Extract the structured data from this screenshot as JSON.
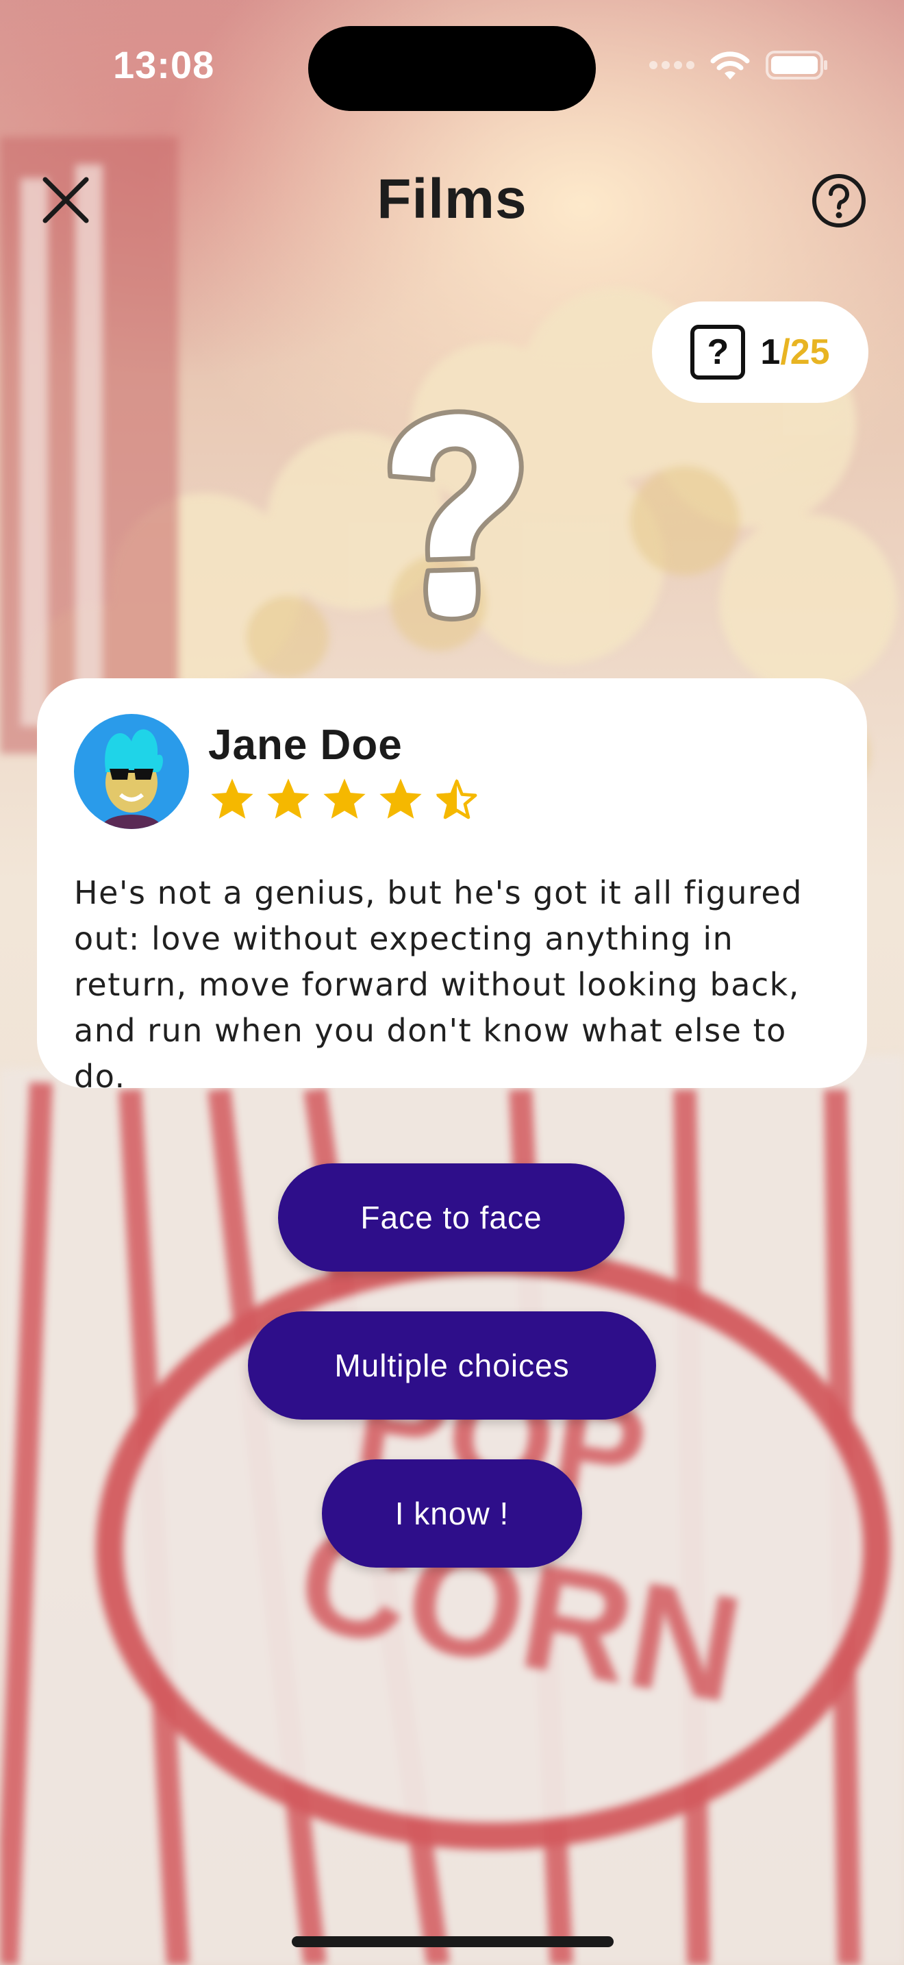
{
  "status_bar": {
    "time": "13:08"
  },
  "header": {
    "title": "Films",
    "close_icon": "close-icon",
    "help_icon": "help-circle-icon"
  },
  "counter": {
    "icon": "question-box-icon",
    "current": "1",
    "separator": "/",
    "total": "25"
  },
  "review": {
    "reviewer_name": "Jane Doe",
    "rating": 4.5,
    "rating_max": 5,
    "text": "He's not a genius, but he's got it all figured out: love without expecting anything in return, move forward without looking back, and run when you don't know what else to do."
  },
  "actions": {
    "face_to_face": "Face to face",
    "multiple_choices": "Multiple choices",
    "i_know": "I know !"
  },
  "colors": {
    "accent": "#2e0e8a",
    "counter_total": "#e8b422",
    "star": "#f5b800"
  }
}
